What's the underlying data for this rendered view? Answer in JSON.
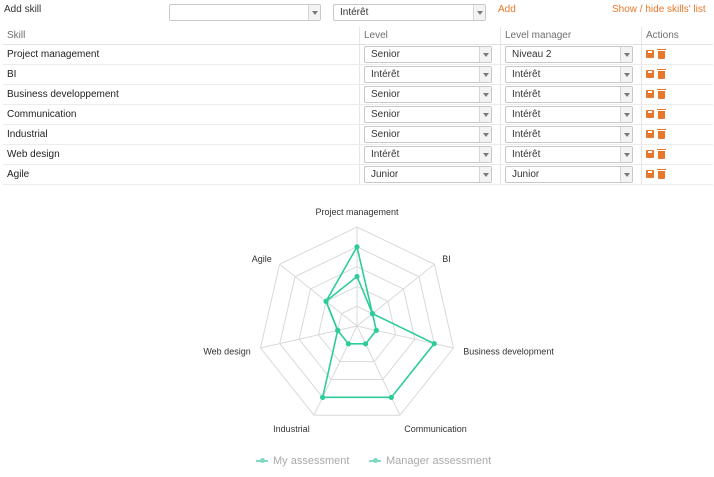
{
  "header": {
    "add_skill_label": "Add skill",
    "skill_select_value": "",
    "level_select_value": "Intérêt",
    "add_link": "Add",
    "toggle_link": "Show / hide skills' list"
  },
  "table": {
    "columns": [
      "Skill",
      "Level",
      "Level manager",
      "Actions"
    ],
    "rows": [
      {
        "skill": "Project management",
        "level": "Senior",
        "manager": "Niveau 2"
      },
      {
        "skill": "BI",
        "level": "Intérêt",
        "manager": "Intérêt"
      },
      {
        "skill": "Business developpement",
        "level": "Senior",
        "manager": "Intérêt"
      },
      {
        "skill": "Communication",
        "level": "Senior",
        "manager": "Intérêt"
      },
      {
        "skill": "Industrial",
        "level": "Senior",
        "manager": "Intérêt"
      },
      {
        "skill": "Web design",
        "level": "Intérêt",
        "manager": "Intérêt"
      },
      {
        "skill": "Agile",
        "level": "Junior",
        "manager": "Junior"
      }
    ]
  },
  "colors": {
    "accent": "#e8782b",
    "series": "#2ecc9a",
    "legend_inactive": "#aaaaaa"
  },
  "chart_data": {
    "type": "radar",
    "categories": [
      "Project management",
      "BI",
      "Business development",
      "Communication",
      "Industrial",
      "Web design",
      "Agile"
    ],
    "rmax": 5,
    "levels": 5,
    "series": [
      {
        "name": "My assessment",
        "values": [
          4,
          1,
          4,
          4,
          4,
          1,
          2
        ]
      },
      {
        "name": "Manager assessment",
        "values": [
          2.5,
          1,
          1,
          1,
          1,
          1,
          2
        ]
      }
    ],
    "legend": "bottom-center"
  }
}
